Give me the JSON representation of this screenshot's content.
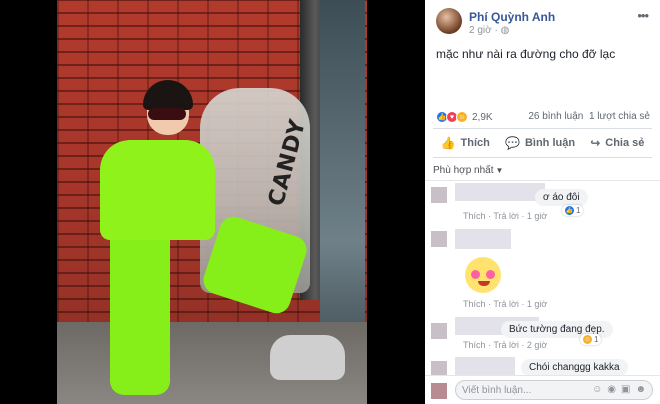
{
  "post": {
    "author": "Phí Quỳnh Anh",
    "time": "2 giờ · ",
    "globe_icon": "globe-icon",
    "caption": "mặc như nài ra đường cho đỡ lạc",
    "mural_text": "CANDY"
  },
  "reactions": {
    "count": "2,9K",
    "types": [
      "like",
      "love",
      "haha"
    ],
    "comments": "26 bình luận",
    "shares": "1 lượt chia sẻ"
  },
  "actions": [
    {
      "label": "Thích",
      "icon": "like-icon"
    },
    {
      "label": "Bình luận",
      "icon": "comment-icon"
    },
    {
      "label": "Chia sẻ",
      "icon": "share-icon"
    }
  ],
  "sort": {
    "label": "Phù hợp nhất"
  },
  "comments": [
    {
      "text": "ơ áo đôi",
      "reply_label": "Thích · Trả lời · 1 giờ",
      "reaction_count": "1"
    },
    {
      "text": "",
      "reply_label": "Thích · Trả lời · 1 giờ",
      "sticker": "love-eyes-sticker"
    },
    {
      "text": "Bức tường đang đẹp.",
      "reply_label": "Thích · Trả lời · 2 giờ",
      "reaction_count": "1"
    },
    {
      "text": "Chói changgg kakka"
    }
  ],
  "input": {
    "placeholder": "Viết bình luận..."
  },
  "colors": {
    "link": "#385898",
    "like": "#1877f2",
    "love": "#f33e58",
    "haha": "#f7b125"
  }
}
